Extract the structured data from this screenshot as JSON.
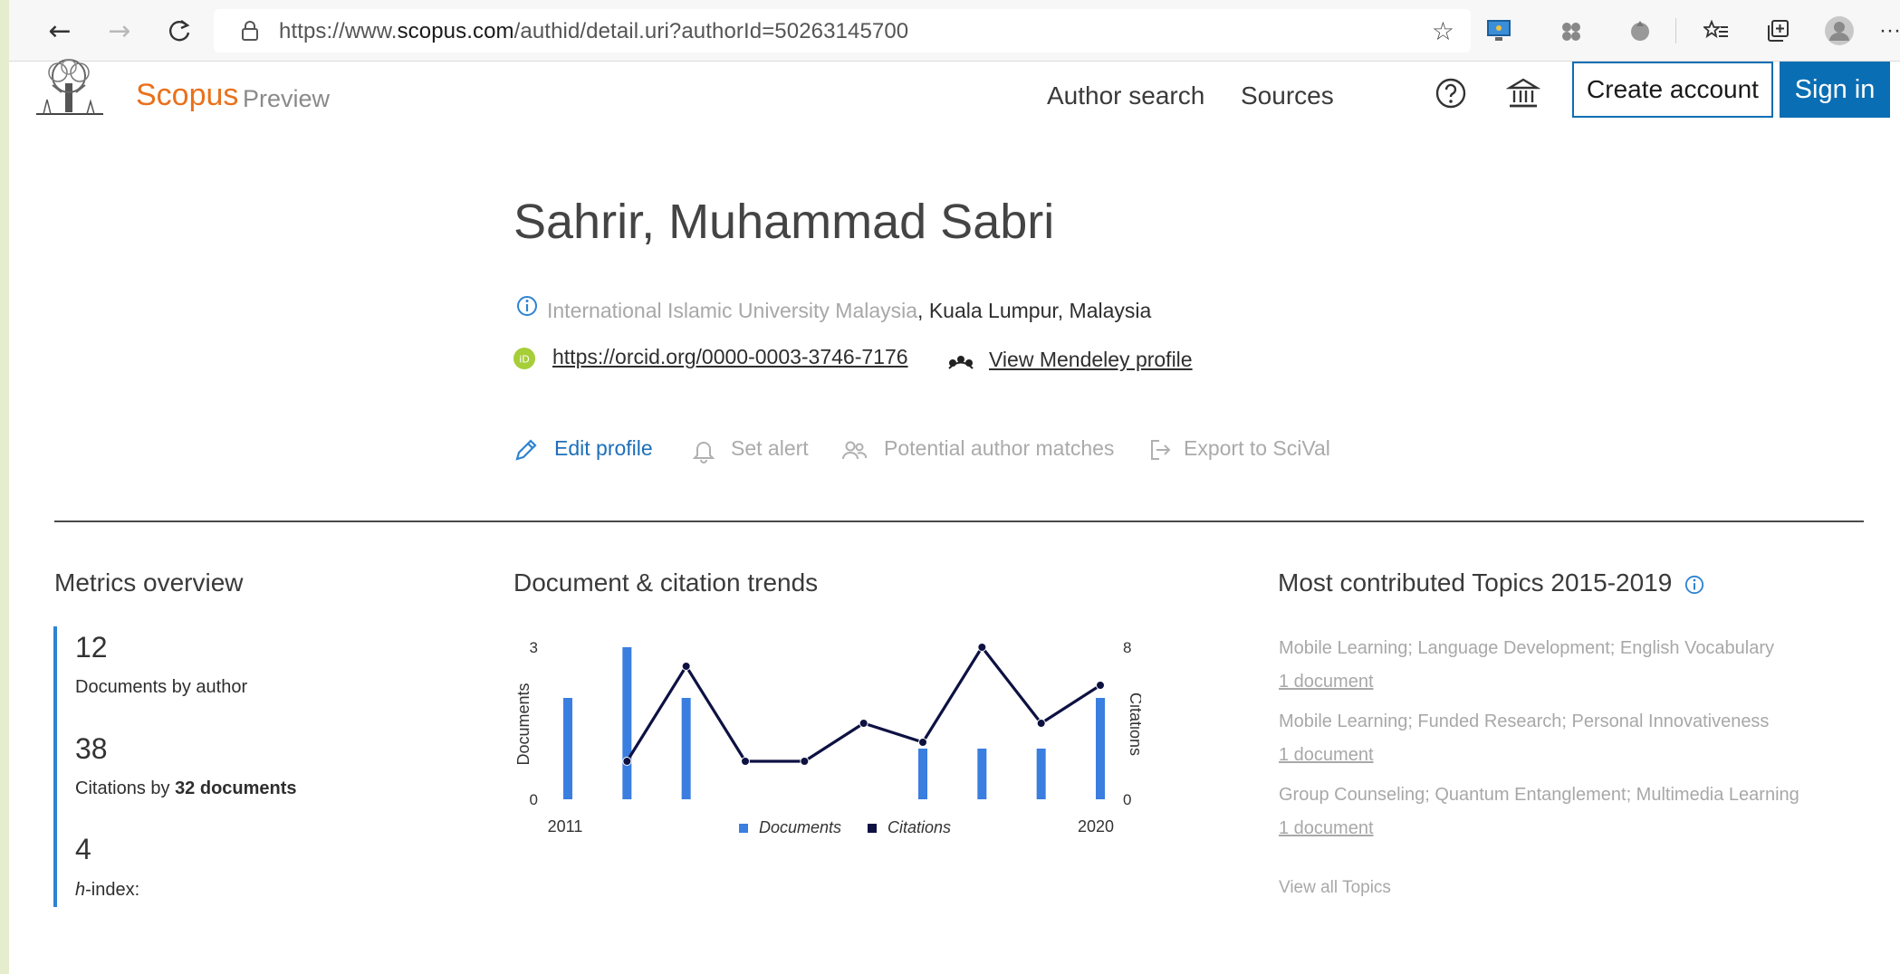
{
  "browser": {
    "url_prefix": "https://www.",
    "url_domain": "scopus.com",
    "url_path": "/authid/detail.uri?authorId=50263145700"
  },
  "header": {
    "brand": "Scopus",
    "brand_sub": "Preview",
    "nav": [
      "Author search",
      "Sources"
    ],
    "create_account": "Create account",
    "sign_in": "Sign in"
  },
  "profile": {
    "name": "Sahrir, Muhammad Sabri",
    "affiliation_link": "International Islamic University Malaysia",
    "affiliation_rest": ", Kuala Lumpur, Malaysia",
    "orcid": "https://orcid.org/0000-0003-3746-7176",
    "mendeley": "View Mendeley profile",
    "actions": [
      "Edit profile",
      "Set alert",
      "Potential author matches",
      "Export to SciVal"
    ]
  },
  "metrics": {
    "title": "Metrics overview",
    "items": [
      {
        "value": "12",
        "label": "Documents by author"
      },
      {
        "value": "38",
        "label_prefix": "Citations by ",
        "label_bold": "32 documents"
      },
      {
        "value": "4",
        "label_italic": "h",
        "label_suffix": "-index:"
      }
    ]
  },
  "trends": {
    "title": "Document & citation trends"
  },
  "chart_data": {
    "type": "bar",
    "categories": [
      2011,
      2012,
      2013,
      2014,
      2015,
      2016,
      2017,
      2018,
      2019,
      2020
    ],
    "xticks": [
      "2011",
      "2020"
    ],
    "series": [
      {
        "name": "Documents",
        "type": "bar",
        "axis": "left",
        "values": [
          2,
          3,
          2,
          0,
          0,
          0,
          1,
          1,
          1,
          2
        ]
      },
      {
        "name": "Citations",
        "type": "line",
        "axis": "right",
        "values": [
          null,
          2,
          7,
          2,
          2,
          4,
          3,
          8,
          4,
          6
        ]
      }
    ],
    "ylabel": "Documents",
    "ylabel_right": "Citations",
    "ylim": [
      0,
      3
    ],
    "ylim_right": [
      0,
      8
    ],
    "yticks": [
      "0",
      "3"
    ],
    "yticks_right": [
      "0",
      "8"
    ],
    "legend": "bottom",
    "colors": {
      "documents": "#3a7ee0",
      "citations": "#0d1142"
    }
  },
  "topics": {
    "title": "Most contributed Topics 2015-2019",
    "items": [
      {
        "name": "Mobile Learning; Language Development; English Vocabulary",
        "count": "1 document"
      },
      {
        "name": "Mobile Learning; Funded Research; Personal Innovativeness",
        "count": "1 document"
      },
      {
        "name": "Group Counseling; Quantum Entanglement; Multimedia Learning",
        "count": "1 document"
      }
    ],
    "view_all": "View all Topics"
  },
  "colors": {
    "brand": "#e9711c",
    "accent": "#0a6eb4",
    "bar": "#3a7ee0",
    "line": "#0d1142"
  }
}
